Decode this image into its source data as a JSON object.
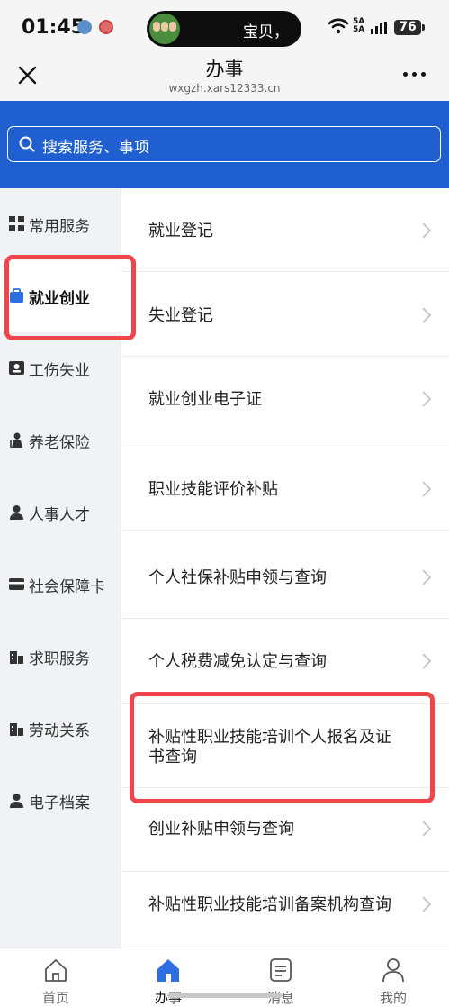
{
  "status_bar": {
    "time": "01:45",
    "pill_text": "宝贝，",
    "signal_text_top": "5A",
    "signal_text_bottom": "5A",
    "battery": "76"
  },
  "header": {
    "title": "办事",
    "url": "wxgzh.xars12333.cn"
  },
  "search": {
    "placeholder": "搜索服务、事项"
  },
  "sidebar": {
    "items": [
      {
        "label": "常用服务",
        "icon": "grid-icon"
      },
      {
        "label": "就业创业",
        "icon": "briefcase-icon"
      },
      {
        "label": "工伤失业",
        "icon": "id-card-icon"
      },
      {
        "label": "养老保险",
        "icon": "elder-person-icon"
      },
      {
        "label": "人事人才",
        "icon": "person-icon"
      },
      {
        "label": "社会保障卡",
        "icon": "card-icon"
      },
      {
        "label": "求职服务",
        "icon": "building-icon"
      },
      {
        "label": "劳动关系",
        "icon": "building-icon"
      },
      {
        "label": "电子档案",
        "icon": "person-icon"
      }
    ],
    "active_index": 1
  },
  "services": [
    {
      "label": "就业登记"
    },
    {
      "label": "失业登记"
    },
    {
      "label": "就业创业电子证"
    },
    {
      "label": "职业技能评价补贴"
    },
    {
      "label": "个人社保补贴申领与查询"
    },
    {
      "label": "个人税费减免认定与查询"
    },
    {
      "label": "补贴性职业技能培训个人报名及证书查询"
    },
    {
      "label": "创业补贴申领与查询"
    },
    {
      "label": "补贴性职业技能培训备案机构查询"
    }
  ],
  "bottom_nav": {
    "tabs": [
      {
        "label": "首页",
        "icon": "house-outline-icon"
      },
      {
        "label": "办事",
        "icon": "house-filled-icon"
      },
      {
        "label": "消息",
        "icon": "message-icon"
      },
      {
        "label": "我的",
        "icon": "user-icon"
      }
    ],
    "active_index": 1
  },
  "colors": {
    "brand_blue": "#1f5fd0",
    "highlight_red": "#f0464b",
    "sidebar_bg": "#f0f2f6"
  }
}
